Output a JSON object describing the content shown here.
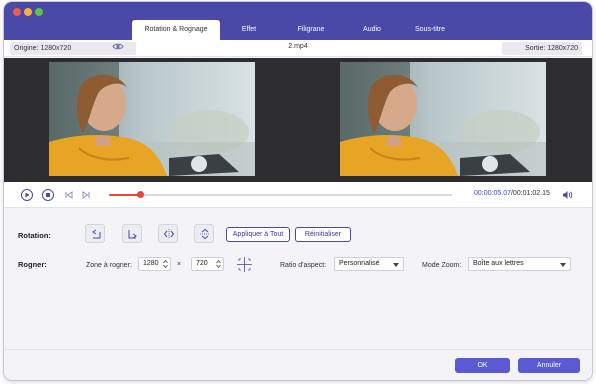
{
  "tabs": [
    {
      "label": "Rotation & Rognage"
    },
    {
      "label": "Effet"
    },
    {
      "label": "Filigrane"
    },
    {
      "label": "Audio"
    },
    {
      "label": "Sous-titre"
    }
  ],
  "info": {
    "origin": "Origine: 1280x720",
    "file_name": "2.mp4",
    "output": "Sortie: 1280x720"
  },
  "player": {
    "current_time": "00:00:05.07",
    "total_time": "/00:01:02.15",
    "progress": 0.09
  },
  "rotation": {
    "label": "Rotation:",
    "apply_all": "Appliquer à Tout",
    "reset": "Réinitialiser"
  },
  "crop": {
    "label": "Rogner:",
    "zone_label": "Zone à rogner:",
    "width": "1280",
    "times": "×",
    "height": "720",
    "aspect_label": "Ratio d'aspect:",
    "aspect_value": "Personnalisé",
    "zoom_label": "Mode Zoom:",
    "zoom_value": "Boîte aux lettres"
  },
  "footer": {
    "ok": "OK",
    "cancel": "Annuler"
  },
  "colors": {
    "accent": "#4a49a8",
    "primary_button": "#5b5ad4",
    "progress": "#e8453c",
    "time_current": "#3a4bd8"
  }
}
